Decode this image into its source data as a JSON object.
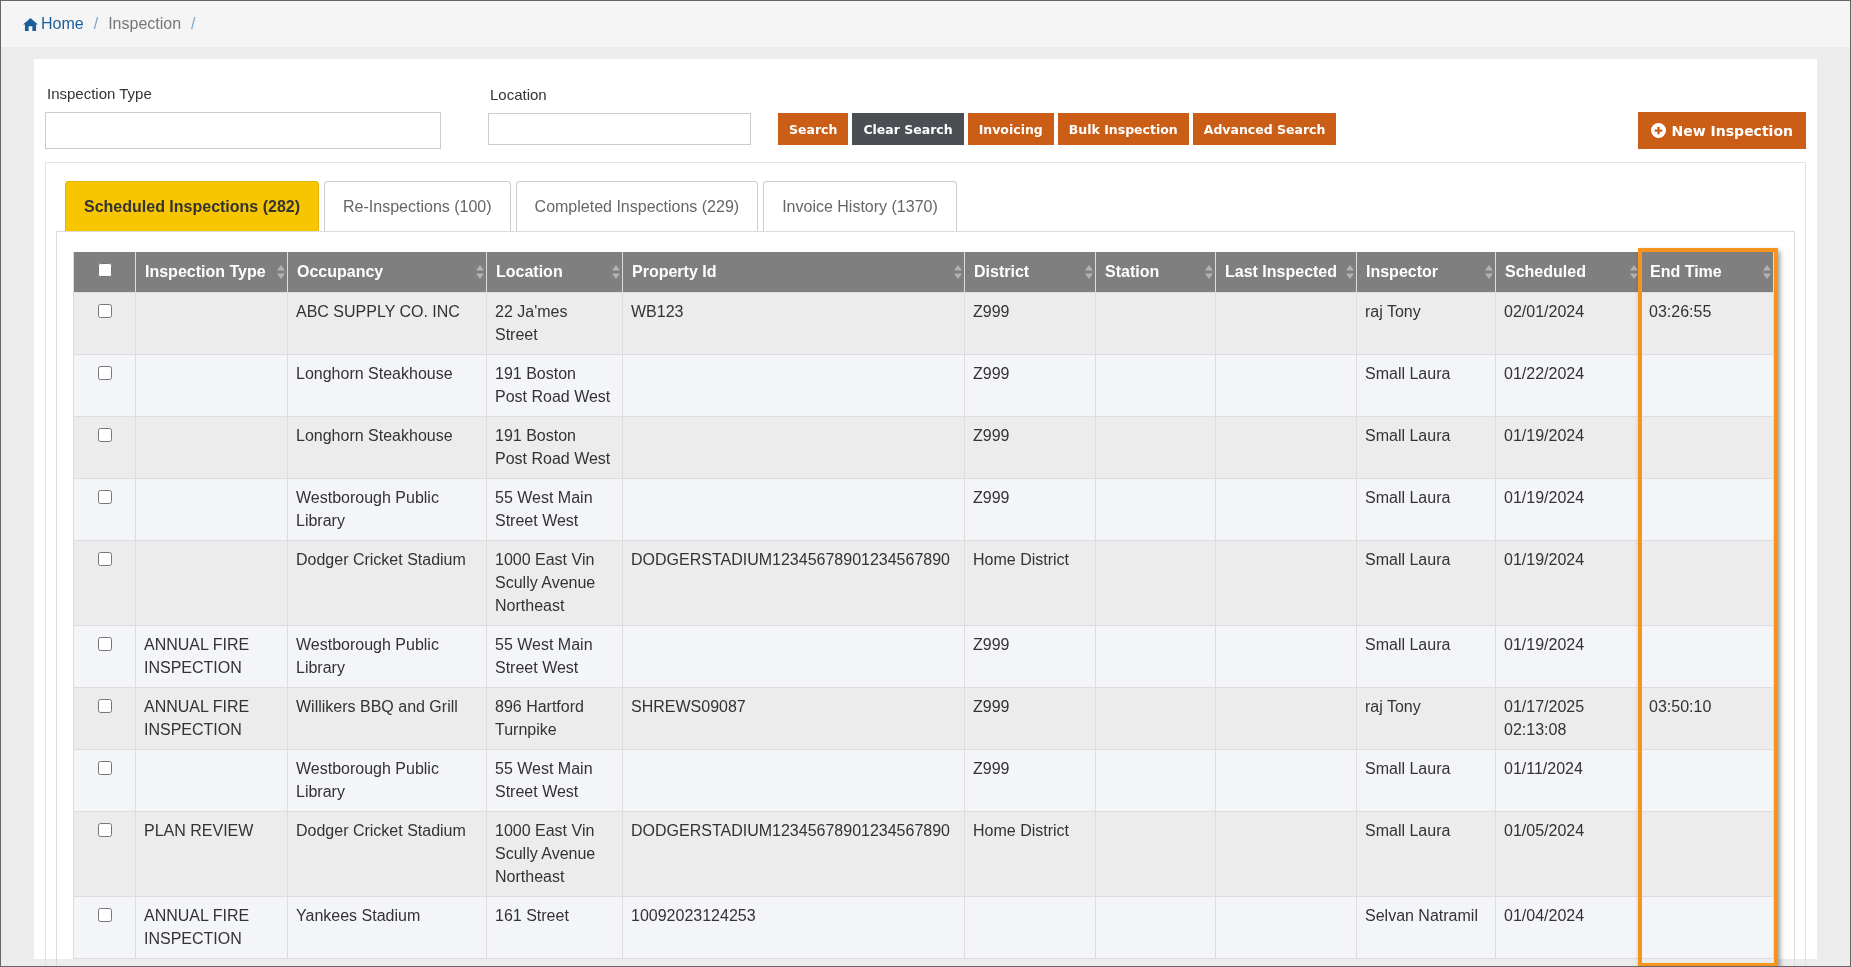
{
  "breadcrumb": [
    {
      "label": "Home",
      "kind": "home",
      "separator": "/"
    },
    {
      "label": "Inspection",
      "kind": "current",
      "separator": "/"
    }
  ],
  "filters": [
    {
      "label": "Inspection Type",
      "kind": "wide"
    },
    {
      "label": "Location",
      "kind": "narrow"
    }
  ],
  "buttons": [
    {
      "label": "Search",
      "kind": "primary"
    },
    {
      "label": "Clear Search",
      "kind": "dark"
    },
    {
      "label": "Invoicing",
      "kind": "primary"
    },
    {
      "label": "Bulk Inspection",
      "kind": "primary"
    },
    {
      "label": "Advanced Search",
      "kind": "primary"
    }
  ],
  "new_button": {
    "label": "New Inspection"
  },
  "tabs": [
    {
      "label": "Scheduled Inspections (282)",
      "selected": true
    },
    {
      "label": "Re-Inspections (100)",
      "selected": false
    },
    {
      "label": "Completed Inspections (229)",
      "selected": false
    },
    {
      "label": "Invoice History (1370)",
      "selected": false
    }
  ],
  "table": {
    "select_all": {
      "checked": false
    },
    "columns": [
      {
        "label": "Inspection Type",
        "highlighted": false
      },
      {
        "label": "Occupancy",
        "highlighted": false
      },
      {
        "label": "Location",
        "highlighted": false
      },
      {
        "label": "Property Id",
        "highlighted": false
      },
      {
        "label": "District",
        "highlighted": false
      },
      {
        "label": "Station",
        "highlighted": false
      },
      {
        "label": "Last Inspected",
        "highlighted": false
      },
      {
        "label": "Inspector",
        "highlighted": false
      },
      {
        "label": "Scheduled",
        "highlighted": false
      },
      {
        "label": "End Time",
        "highlighted": true
      }
    ],
    "rows": [
      {
        "checked": false,
        "cells": {
          "occupancy": "ABC SUPPLY CO. INC",
          "location": "22 Ja'mes Street",
          "property_id": "WB123",
          "district": "Z999",
          "inspector": "raj Tony",
          "scheduled": "02/01/2024",
          "end_time": "03:26:55"
        }
      },
      {
        "checked": false,
        "cells": {
          "occupancy": "Longhorn Steakhouse",
          "location": "191 Boston Post Road West",
          "district": "Z999",
          "inspector": "Small Laura",
          "scheduled": "01/22/2024"
        }
      },
      {
        "checked": false,
        "cells": {
          "occupancy": "Longhorn Steakhouse",
          "location": "191 Boston Post Road West",
          "district": "Z999",
          "inspector": "Small Laura",
          "scheduled": "01/19/2024"
        }
      },
      {
        "checked": false,
        "cells": {
          "occupancy": "Westborough Public Library",
          "location": "55 West Main Street West",
          "district": "Z999",
          "inspector": "Small Laura",
          "scheduled": "01/19/2024"
        }
      },
      {
        "checked": false,
        "cells": {
          "occupancy": "Dodger Cricket Stadium",
          "location": "1000 East Vin Scully Avenue Northeast",
          "property_id": "DODGERSTADIUM12345678901234567890",
          "district": "Home District",
          "inspector": "Small Laura",
          "scheduled": "01/19/2024"
        }
      },
      {
        "checked": false,
        "cells": {
          "inspection_type": "ANNUAL FIRE INSPECTION",
          "occupancy": "Westborough Public Library",
          "location": "55 West Main Street West",
          "district": "Z999",
          "inspector": "Small Laura",
          "scheduled": "01/19/2024"
        }
      },
      {
        "checked": false,
        "cells": {
          "inspection_type": "ANNUAL FIRE INSPECTION",
          "occupancy": "Willikers BBQ and Grill",
          "location": "896 Hartford Turnpike",
          "property_id": "SHREWS09087",
          "district": "Z999",
          "inspector": "raj Tony",
          "scheduled": "01/17/2025 02:13:08",
          "end_time": "03:50:10"
        }
      },
      {
        "checked": false,
        "cells": {
          "occupancy": "Westborough Public Library",
          "location": "55 West Main Street West",
          "district": "Z999",
          "inspector": "Small Laura",
          "scheduled": "01/11/2024"
        }
      },
      {
        "checked": false,
        "cells": {
          "inspection_type": "PLAN REVIEW",
          "occupancy": "Dodger Cricket Stadium",
          "location": "1000 East Vin Scully Avenue Northeast",
          "property_id": "DODGERSTADIUM12345678901234567890",
          "district": "Home District",
          "inspector": "Small Laura",
          "scheduled": "01/05/2024"
        }
      },
      {
        "checked": false,
        "cells": {
          "inspection_type": "ANNUAL FIRE INSPECTION",
          "occupancy": "Yankees Stadium",
          "location": "161 Street",
          "property_id": "10092023124253",
          "inspector": "Selvan Natramil",
          "scheduled": "01/04/2024"
        }
      }
    ]
  }
}
